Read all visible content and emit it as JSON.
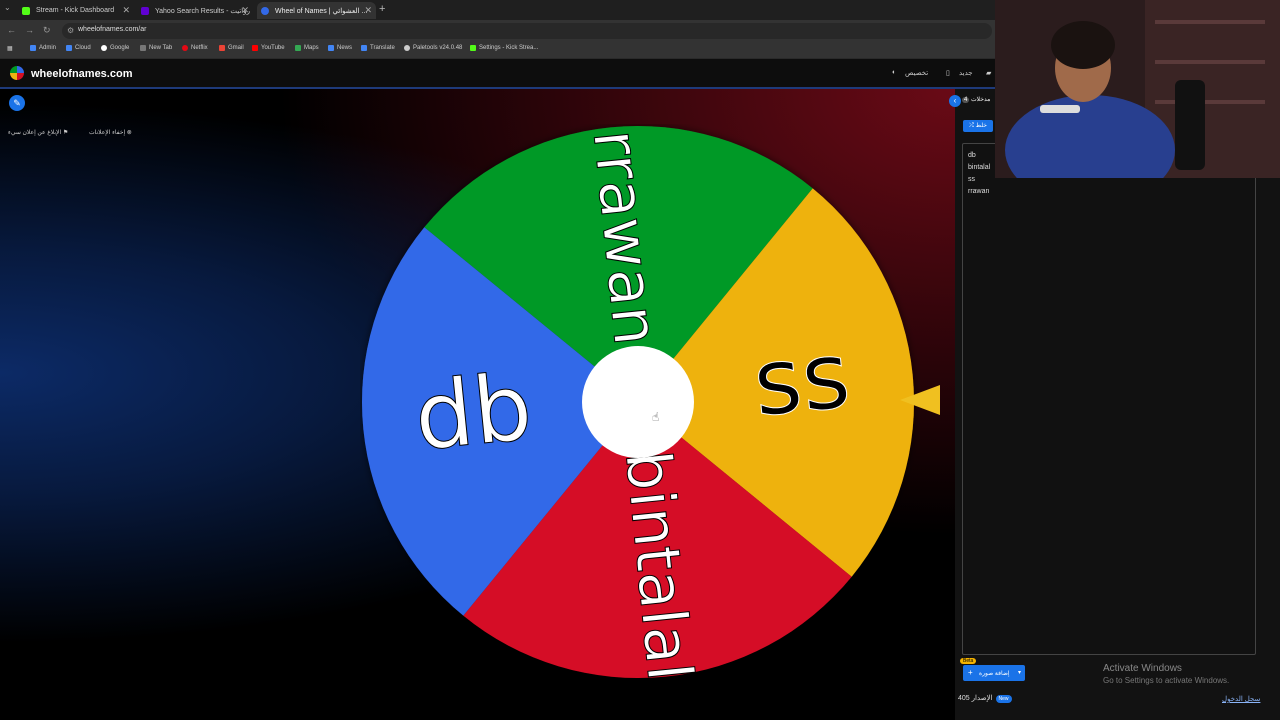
{
  "browser": {
    "tabs": [
      {
        "title": "Stream - Kick Dashboard",
        "fav_color": "#53fc18"
      },
      {
        "title": "Yahoo Search Results - رواتيت",
        "fav_color": "#6001d2"
      },
      {
        "title": "Wheel of Names | العشوائي ...",
        "fav_color": "#3369e8"
      }
    ],
    "url": "wheelofnames.com/ar",
    "bookmarks": [
      {
        "label": "Admin",
        "color": "#4285f4"
      },
      {
        "label": "Cloud",
        "color": "#4285f4"
      },
      {
        "label": "Google",
        "color": "#ffffff"
      },
      {
        "label": "New Tab",
        "color": "#777777"
      },
      {
        "label": "Netflix",
        "color": "#e50914"
      },
      {
        "label": "Gmail",
        "color": "#ea4335"
      },
      {
        "label": "YouTube",
        "color": "#ff0000"
      },
      {
        "label": "Maps",
        "color": "#34a853"
      },
      {
        "label": "News",
        "color": "#4285f4"
      },
      {
        "label": "Translate",
        "color": "#4285f4"
      },
      {
        "label": "Paletools v24.0.48",
        "color": "#cccccc"
      },
      {
        "label": "Settings - Kick Strea...",
        "color": "#53fc18"
      }
    ]
  },
  "site": {
    "name": "wheelofnames.com",
    "header_items": [
      "تخصيص",
      "جديد"
    ]
  },
  "main": {
    "ad_links": [
      "الإبلاغ عن إعلان سيء",
      "إخفاء الإعلانات"
    ]
  },
  "wheel": {
    "segments": [
      {
        "label": "rrawan",
        "color": "#009925"
      },
      {
        "label": "ss",
        "color": "#eeb211"
      },
      {
        "label": "bintalal",
        "color": "#d50f25"
      },
      {
        "label": "db",
        "color": "#3369e8"
      }
    ]
  },
  "panel": {
    "tab_label": "مدخلات",
    "tab_count": "4",
    "shuffle_label": "خلط",
    "entries": [
      "db",
      "bintalal",
      "ss",
      "rrawan"
    ],
    "add_image_label": "إضافة صورة",
    "beta_label": "Beta",
    "version_label": "الإصدار 405",
    "new_badge": "New",
    "login_label": "سجل الدخول"
  },
  "os": {
    "activate_title": "Activate Windows",
    "activate_sub": "Go to Settings to activate Windows."
  }
}
